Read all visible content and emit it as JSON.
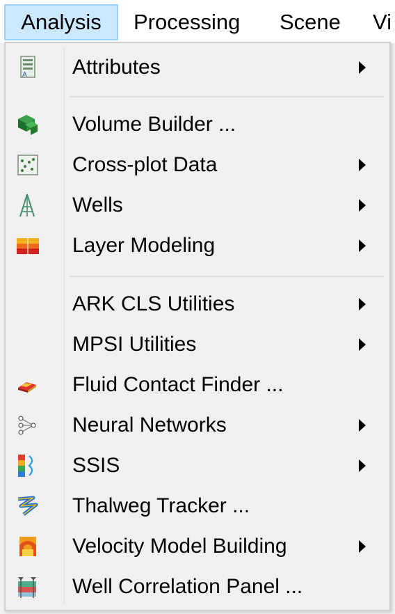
{
  "menubar": {
    "items": [
      {
        "label": "Analysis",
        "active": true
      },
      {
        "label": "Processing",
        "active": false
      },
      {
        "label": "Scene",
        "active": false
      },
      {
        "label": "Vi",
        "active": false
      }
    ]
  },
  "menu": {
    "items": [
      {
        "label": "Attributes",
        "icon": "attributes-icon",
        "submenu": true
      },
      {
        "label": "Volume Builder ...",
        "icon": "volume-builder-icon",
        "submenu": false
      },
      {
        "label": "Cross-plot Data",
        "icon": "cross-plot-icon",
        "submenu": true
      },
      {
        "label": "Wells",
        "icon": "well-derrick-icon",
        "submenu": true
      },
      {
        "label": "Layer Modeling",
        "icon": "layer-modeling-icon",
        "submenu": true
      },
      {
        "label": "ARK CLS Utilities",
        "icon": "",
        "submenu": true
      },
      {
        "label": "MPSI Utilities",
        "icon": "",
        "submenu": true
      },
      {
        "label": "Fluid Contact Finder ...",
        "icon": "fluid-contact-icon",
        "submenu": false
      },
      {
        "label": "Neural Networks",
        "icon": "neural-network-icon",
        "submenu": true
      },
      {
        "label": "SSIS",
        "icon": "ssis-icon",
        "submenu": true
      },
      {
        "label": "Thalweg Tracker ...",
        "icon": "thalweg-tracker-icon",
        "submenu": false
      },
      {
        "label": "Velocity Model Building",
        "icon": "velocity-model-icon",
        "submenu": true
      },
      {
        "label": "Well Correlation Panel ...",
        "icon": "well-correlation-icon",
        "submenu": false
      }
    ]
  },
  "colors": {
    "menubar_active_bg": "#cce8ff",
    "menubar_active_border": "#99d1ff",
    "menu_bg": "#f0f0f0"
  }
}
